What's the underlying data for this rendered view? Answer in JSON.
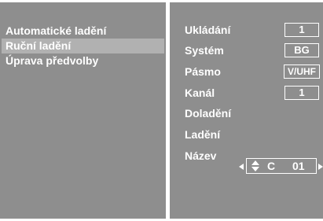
{
  "menu": {
    "items": [
      {
        "label": "Automatické ladění",
        "selected": false
      },
      {
        "label": "Ruční ladění",
        "selected": true
      },
      {
        "label": "Úprava předvolby",
        "selected": false
      }
    ]
  },
  "settings": {
    "ukladani": {
      "label": "Ukládání",
      "value": "1"
    },
    "system": {
      "label": "Systém",
      "value": "BG"
    },
    "pasmo": {
      "label": "Pásmo",
      "value": "V/UHF"
    },
    "kanal": {
      "label": "Kanál",
      "value": "1"
    },
    "dolad": {
      "label": "Doladění"
    },
    "ladeni": {
      "label": "Ladění"
    },
    "nazev": {
      "label": "Název",
      "letter": "C",
      "number": "01"
    }
  },
  "colors": {
    "panel": "#8e8e8e",
    "highlight": "#b1b1b1",
    "text": "#ffffff",
    "background": "#ffffff"
  }
}
